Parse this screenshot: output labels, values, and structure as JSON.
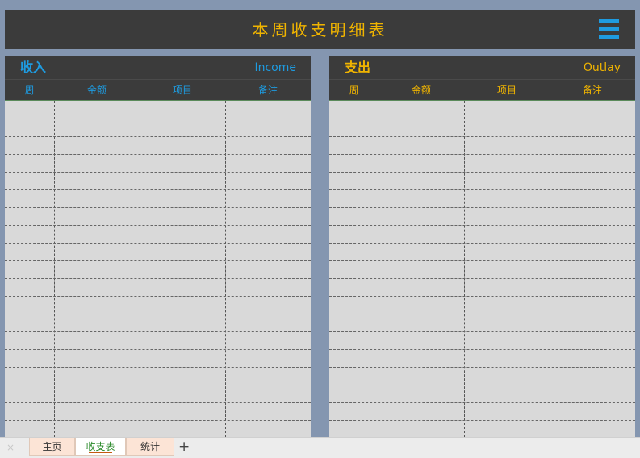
{
  "title": "本周收支明细表",
  "income": {
    "title_zh": "收入",
    "title_en": "Income",
    "columns": [
      "周",
      "金额",
      "项目",
      "备注"
    ],
    "color": "#1e9be0"
  },
  "outlay": {
    "title_zh": "支出",
    "title_en": "Outlay",
    "columns": [
      "周",
      "金额",
      "项目",
      "备注"
    ],
    "color": "#f0b400"
  },
  "tabs": {
    "close": "×",
    "items": [
      "主页",
      "收支表",
      "统计"
    ],
    "active": "收支表",
    "add": "+"
  },
  "icons": {
    "menu": "hamburger-menu-icon"
  },
  "colors": {
    "background": "#8496b0",
    "header_dark": "#3b3b3b",
    "grid": "#d9d9d9",
    "title": "#f0b400"
  }
}
